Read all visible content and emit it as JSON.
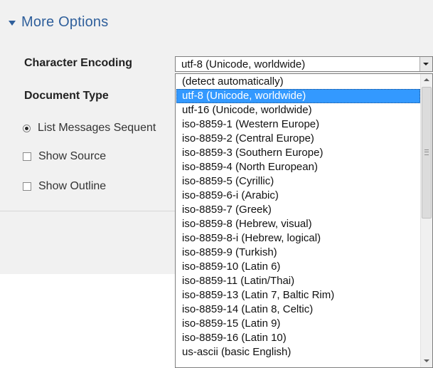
{
  "section": {
    "title": "More Options",
    "toggle_icon": "triangle-down-icon"
  },
  "labels": {
    "character_encoding": "Character Encoding",
    "document_type": "Document Type"
  },
  "options": {
    "list_messages": "List Messages Sequent",
    "list_messages_checked": true,
    "show_source": "Show Source",
    "show_source_checked": false,
    "show_outline": "Show Outline",
    "show_outline_checked": false
  },
  "encoding": {
    "selected_value": "utf-8 (Unicode, worldwide)",
    "items": [
      "(detect automatically)",
      "utf-8 (Unicode, worldwide)",
      "utf-16 (Unicode, worldwide)",
      "iso-8859-1 (Western Europe)",
      "iso-8859-2 (Central Europe)",
      "iso-8859-3 (Southern Europe)",
      "iso-8859-4 (North European)",
      "iso-8859-5 (Cyrillic)",
      "iso-8859-6-i (Arabic)",
      "iso-8859-7 (Greek)",
      "iso-8859-8 (Hebrew, visual)",
      "iso-8859-8-i (Hebrew, logical)",
      "iso-8859-9 (Turkish)",
      "iso-8859-10 (Latin 6)",
      "iso-8859-11 (Latin/Thai)",
      "iso-8859-13 (Latin 7, Baltic Rim)",
      "iso-8859-14 (Latin 8, Celtic)",
      "iso-8859-15 (Latin 9)",
      "iso-8859-16 (Latin 10)",
      "us-ascii (basic English)"
    ],
    "selected_index": 1
  },
  "colors": {
    "accent": "#2f5f9b",
    "selection": "#3399ff",
    "panel_background": "#f1f1f1"
  }
}
